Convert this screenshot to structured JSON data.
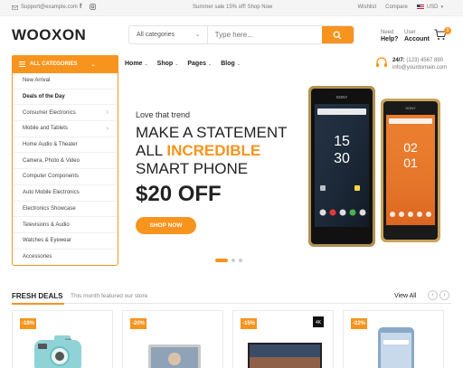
{
  "topbar": {
    "email": "Support@example.com",
    "promo": "Summer sale 15% off! Shop Now",
    "wishlist": "Wishlist",
    "compare": "Compare",
    "currency": "USD"
  },
  "header": {
    "logo": "WOOXON",
    "search_category": "All categories",
    "search_placeholder": "Type here...",
    "need_line1": "Need",
    "need_line2": "Help?",
    "account_line1": "User",
    "account_line2": "Account",
    "cart_count": "0"
  },
  "nav": {
    "all_categories": "ALL CATEGORIES",
    "menu": [
      "Home",
      "Shop",
      "Pages",
      "Blog"
    ],
    "support_hours": "24/7:",
    "support_phone": "(123) 4567 890",
    "support_email": "info@yourdomain.com"
  },
  "sidebar": {
    "items": [
      {
        "label": "New Arrival",
        "has_sub": false
      },
      {
        "label": "Deals of the Day",
        "has_sub": false
      },
      {
        "label": "Consumer Electronics",
        "has_sub": true
      },
      {
        "label": "Mobile and Tablets",
        "has_sub": true
      },
      {
        "label": "Home Audio & Theater",
        "has_sub": false
      },
      {
        "label": "Camera, Photo & Video",
        "has_sub": false
      },
      {
        "label": "Computer Components",
        "has_sub": false
      },
      {
        "label": "Auto Mobile Electronics",
        "has_sub": false
      },
      {
        "label": "Electronics Showcase",
        "has_sub": false
      },
      {
        "label": "Televisions & Audio",
        "has_sub": false
      },
      {
        "label": "Watches & Eyewear",
        "has_sub": false
      },
      {
        "label": "Accessories",
        "has_sub": false
      }
    ]
  },
  "hero": {
    "kicker": "Love that trend",
    "line1": "MAKE A STATEMENT",
    "line2_prefix": "ALL ",
    "line2_highlight": "INCREDIBLE",
    "line3": "SMART PHONE",
    "price": "$20 OFF",
    "button": "SHOP NOW",
    "phone_brand": "SONY",
    "phone1_time": "15",
    "phone1_time2": "30",
    "phone2_time": "02",
    "phone2_time2": "01",
    "slides_count": 3,
    "active_slide": 1
  },
  "deals": {
    "title": "FRESH DEALS",
    "subtitle": "This month featured our store",
    "view_all": "View All",
    "products": [
      {
        "discount": "-18%",
        "kind": "instant camera"
      },
      {
        "discount": "-20%",
        "kind": "laptop"
      },
      {
        "discount": "-15%",
        "kind": "television"
      },
      {
        "discount": "-22%",
        "kind": "smartphone"
      }
    ]
  },
  "colors": {
    "accent": "#f7941d",
    "text": "#222222",
    "muted": "#777777"
  }
}
